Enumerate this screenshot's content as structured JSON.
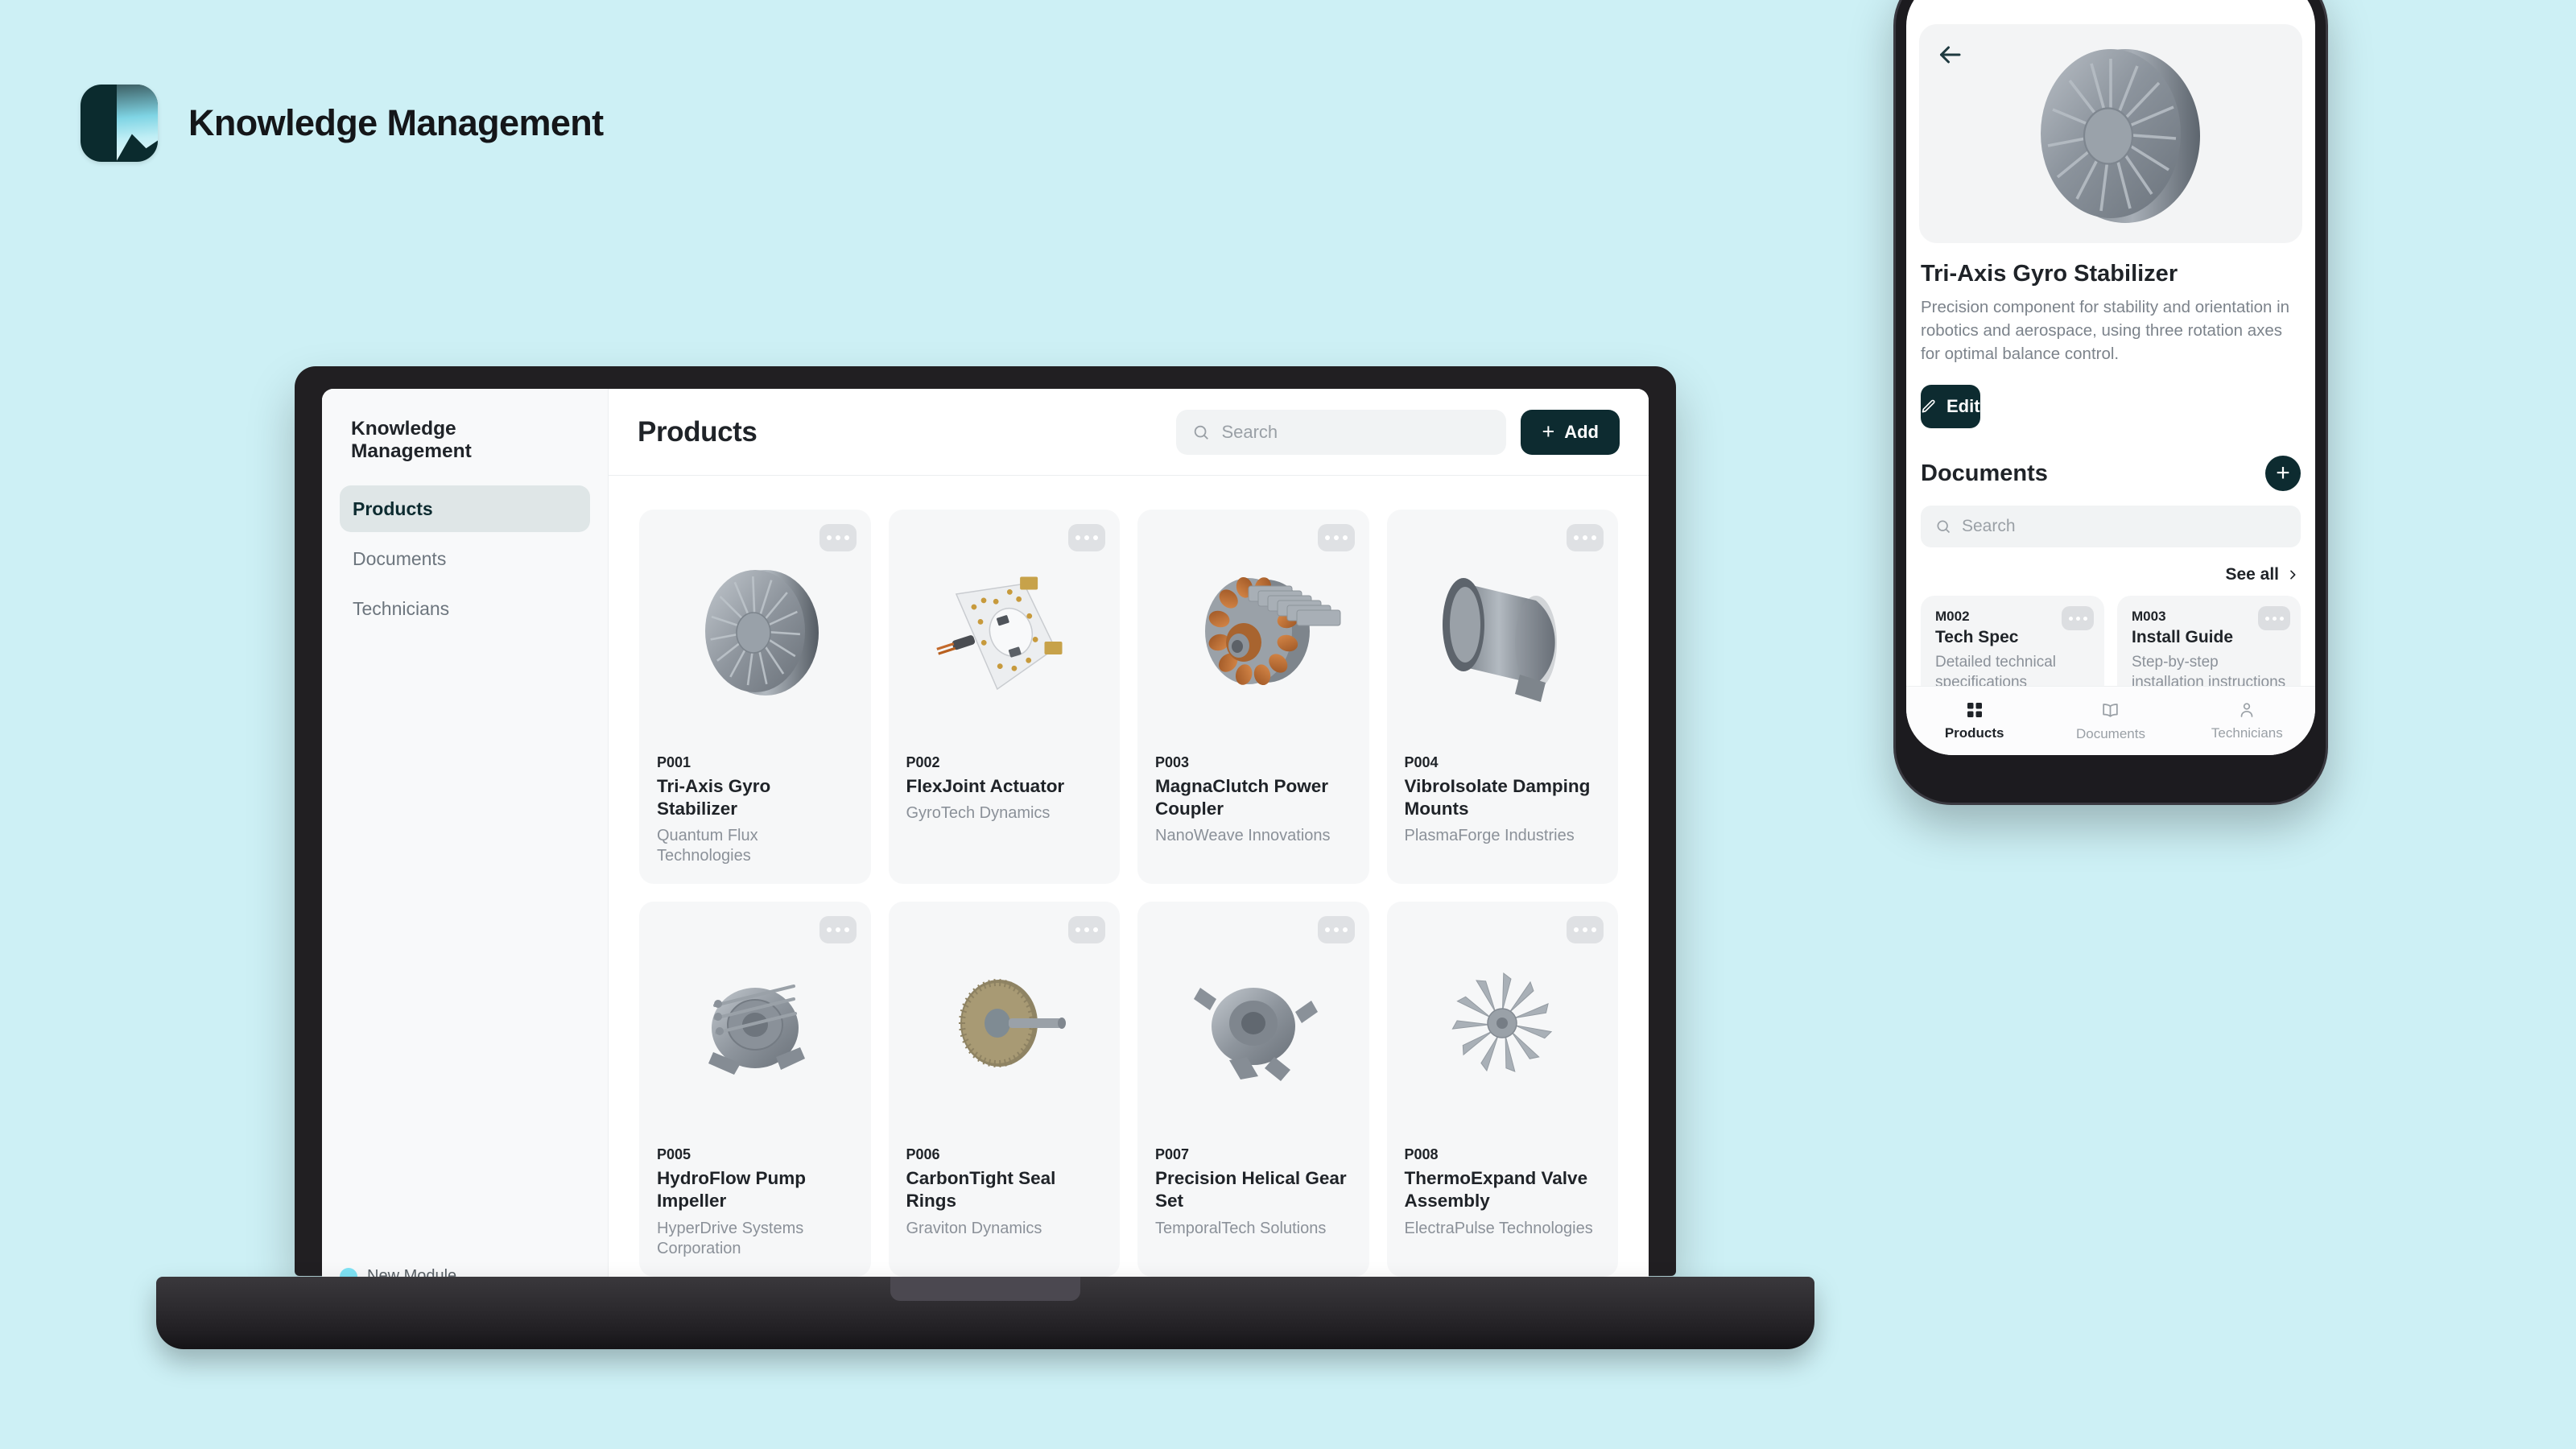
{
  "brand": {
    "title": "Knowledge Management",
    "logo_icon": "app-logo-icon",
    "accent": "#0d2b30",
    "page_bg": "#cdf0f5"
  },
  "desktop": {
    "sidebar": {
      "title": "Knowledge Management",
      "items": [
        {
          "label": "Products",
          "active": true
        },
        {
          "label": "Documents",
          "active": false
        },
        {
          "label": "Technicians",
          "active": false
        }
      ],
      "bottom_label": "New Module"
    },
    "header": {
      "title": "Products",
      "search_placeholder": "Search",
      "search_value": "",
      "search_icon": "search-icon",
      "add_label": "Add",
      "add_icon": "plus-icon"
    },
    "products": [
      {
        "sku": "P001",
        "name": "Tri-Axis Gyro Stabilizer",
        "vendor": "Quantum Flux Technologies",
        "image": "turbine-disc"
      },
      {
        "sku": "P002",
        "name": "FlexJoint Actuator",
        "vendor": "GyroTech Dynamics",
        "image": "circuit-plate"
      },
      {
        "sku": "P003",
        "name": "MagnaClutch Power Coupler",
        "vendor": "NanoWeave Innovations",
        "image": "copper-stator"
      },
      {
        "sku": "P004",
        "name": "VibroIsolate Damping Mounts",
        "vendor": "PlasmaForge Industries",
        "image": "steel-ring"
      },
      {
        "sku": "P005",
        "name": "HydroFlow Pump Impeller",
        "vendor": "HyperDrive Systems Corporation",
        "image": "pump-housing"
      },
      {
        "sku": "P006",
        "name": "CarbonTight Seal Rings",
        "vendor": "Graviton Dynamics",
        "image": "bronze-gear"
      },
      {
        "sku": "P007",
        "name": "Precision Helical Gear Set",
        "vendor": "TemporalTech Solutions",
        "image": "valve-body"
      },
      {
        "sku": "P008",
        "name": "ThermoExpand Valve Assembly",
        "vendor": "ElectraPulse Technologies",
        "image": "fan-blade"
      }
    ],
    "card_menu_icon": "more-options-icon"
  },
  "phone": {
    "back_icon": "back-arrow-icon",
    "hero_image": "turbine-disc",
    "product": {
      "title": "Tri-Axis Gyro Stabilizer",
      "description": "Precision component for stability and orientation in robotics and aerospace, using three rotation axes for optimal balance control.",
      "edit_label": "Edit",
      "edit_icon": "pencil-icon"
    },
    "documents": {
      "heading": "Documents",
      "add_icon": "plus-circle-icon",
      "search_placeholder": "Search",
      "search_value": "",
      "search_icon": "search-icon",
      "see_all_label": "See all",
      "see_all_icon": "chevron-right-icon",
      "items": [
        {
          "sku": "M002",
          "name": "Tech Spec",
          "desc": "Detailed technical specifications including dimensions,"
        },
        {
          "sku": "M003",
          "name": "Install Guide",
          "desc": "Step-by-step installation instructions for"
        }
      ]
    },
    "tabs": [
      {
        "label": "Products",
        "icon": "grid-icon",
        "active": true
      },
      {
        "label": "Documents",
        "icon": "book-icon",
        "active": false
      },
      {
        "label": "Technicians",
        "icon": "person-icon",
        "active": false
      }
    ]
  }
}
